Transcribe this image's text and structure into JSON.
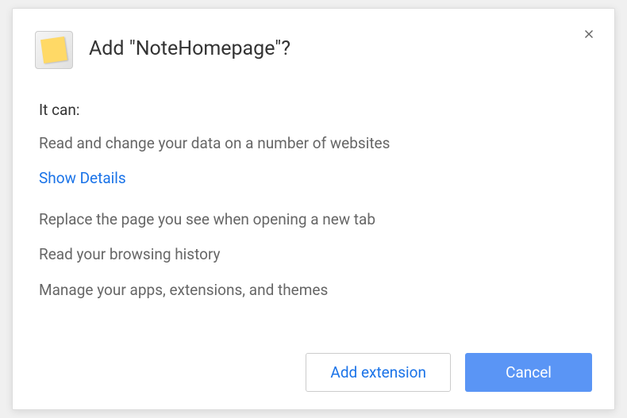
{
  "dialog": {
    "title": "Add \"NoteHomepage\"?",
    "permissions_intro": "It can:",
    "permissions": [
      "Read and change your data on a number of websites",
      "Replace the page you see when opening a new tab",
      "Read your browsing history",
      "Manage your apps, extensions, and themes"
    ],
    "show_details": "Show Details",
    "buttons": {
      "confirm": "Add extension",
      "cancel": "Cancel"
    }
  }
}
